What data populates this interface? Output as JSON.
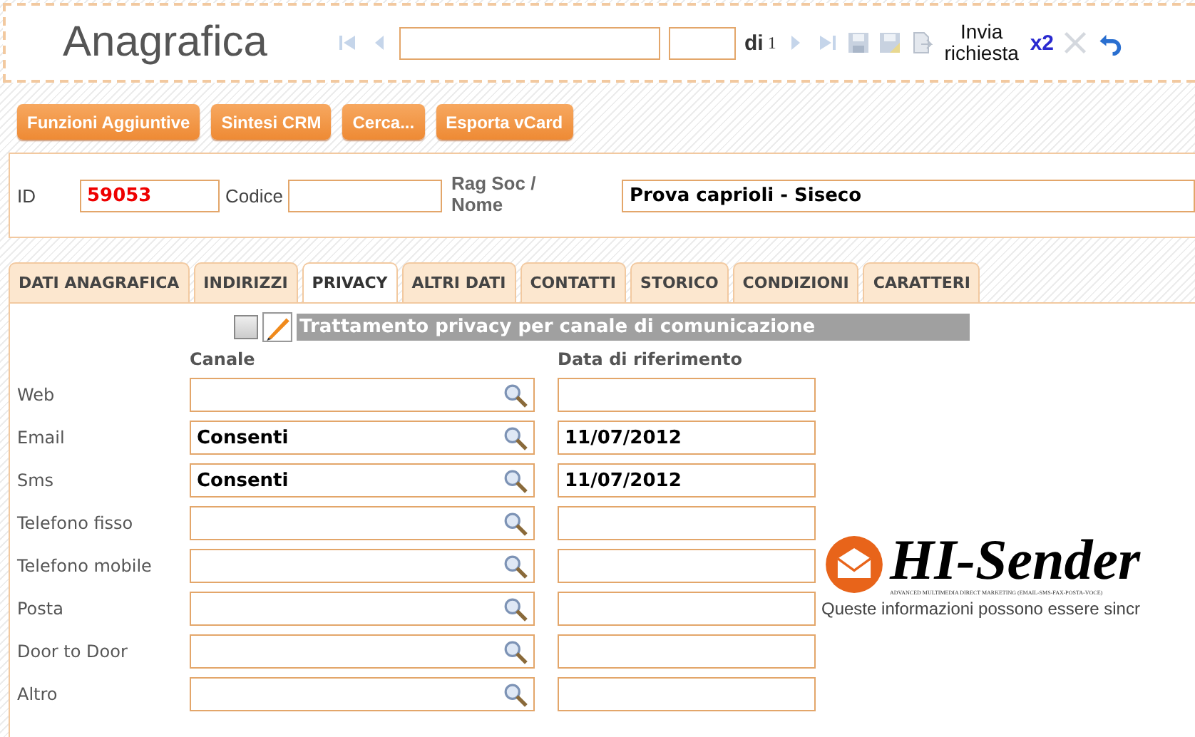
{
  "header": {
    "title": "Anagrafica",
    "of_label": "di",
    "page_count": "1",
    "send_label": "Invia richiesta",
    "multiplier": "x2"
  },
  "actions": [
    "Funzioni Aggiuntive",
    "Sintesi CRM",
    "Cerca...",
    "Esporta vCard"
  ],
  "record": {
    "id_label": "ID",
    "id_value": "59053",
    "code_label": "Codice",
    "name_label": "Rag Soc / Nome",
    "name_value": "Prova caprioli - Siseco"
  },
  "tabs": [
    {
      "label": "DATI ANAGRAFICA",
      "selected": false
    },
    {
      "label": "INDIRIZZI",
      "selected": false
    },
    {
      "label": "PRIVACY",
      "selected": true
    },
    {
      "label": "ALTRI DATI",
      "selected": false
    },
    {
      "label": "CONTATTI",
      "selected": false
    },
    {
      "label": "STORICO",
      "selected": false
    },
    {
      "label": "CONDIZIONI",
      "selected": false
    },
    {
      "label": "CARATTERI",
      "selected": false
    }
  ],
  "privacy": {
    "checked": false,
    "heading": "Trattamento privacy per canale di comunicazione",
    "columns": [
      "Canale",
      "Data di riferimento"
    ],
    "rows": [
      {
        "label": "Web"
      },
      {
        "label": "Email",
        "channel": "Consenti",
        "date": "11/07/2012"
      },
      {
        "label": "Sms",
        "channel": "Consenti",
        "date": "11/07/2012"
      },
      {
        "label": "Telefono fisso"
      },
      {
        "label": "Telefono mobile"
      },
      {
        "label": "Posta"
      },
      {
        "label": "Door to Door"
      },
      {
        "label": "Altro"
      }
    ]
  },
  "logo": {
    "name": "HI-Sender",
    "tagline": "ADVANCED MULTIMEDIA DIRECT MARKETING (EMAIL-SMS-FAX-POSTA-VOCE)",
    "note": "Queste informazioni possono essere sincr"
  }
}
